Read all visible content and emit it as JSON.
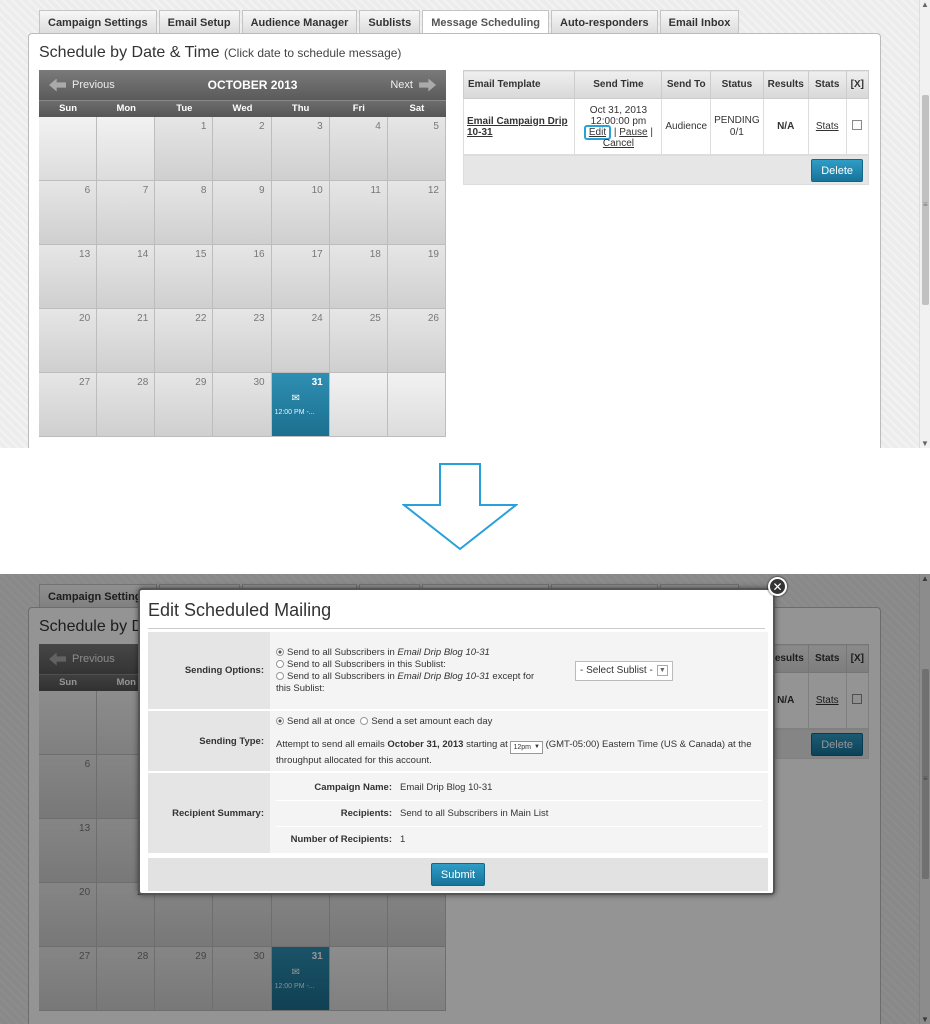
{
  "tabs": [
    "Campaign Settings",
    "Email Setup",
    "Audience Manager",
    "Sublists",
    "Message Scheduling",
    "Auto-responders",
    "Email Inbox"
  ],
  "active_tab": "Message Scheduling",
  "schedule": {
    "title": "Schedule by Date & Time",
    "hint": "(Click date to schedule message)"
  },
  "calendar": {
    "prev_label": "Previous",
    "next_label": "Next",
    "month": "OCTOBER 2013",
    "weekdays": [
      "Sun",
      "Mon",
      "Tue",
      "Wed",
      "Thu",
      "Fri",
      "Sat"
    ],
    "weeks": [
      [
        "",
        "",
        "1",
        "2",
        "3",
        "4",
        "5"
      ],
      [
        "6",
        "7",
        "8",
        "9",
        "10",
        "11",
        "12"
      ],
      [
        "13",
        "14",
        "15",
        "16",
        "17",
        "18",
        "19"
      ],
      [
        "20",
        "21",
        "22",
        "23",
        "24",
        "25",
        "26"
      ],
      [
        "27",
        "28",
        "29",
        "30",
        "31",
        "",
        ""
      ]
    ],
    "event_day": "31",
    "event_time": "12:00 PM -..."
  },
  "table": {
    "headers": [
      "Email Template",
      "Send Time",
      "Send To",
      "Status",
      "Results",
      "Stats",
      "[X]"
    ],
    "row": {
      "template": "Email Campaign Drip 10-31",
      "send_date": "Oct 31, 2013",
      "send_time": "12:00:00 pm",
      "edit": "Edit",
      "pause": "Pause",
      "cancel": "Cancel",
      "send_to": "Audience",
      "status": "PENDING",
      "status_count": "0/1",
      "results": "N/A",
      "stats": "Stats"
    },
    "delete_label": "Delete"
  },
  "modal": {
    "title": "Edit Scheduled Mailing",
    "sending_options_label": "Sending Options:",
    "opt1_pre": "Send to all Subscribers in ",
    "opt1_em": "Email Drip Blog 10-31",
    "opt2": "Send to all Subscribers in this Sublist:",
    "opt3_pre": "Send to all Subscribers in ",
    "opt3_em": "Email Drip Blog 10-31",
    "opt3_post": " except for this Sublist:",
    "sublist_select": "- Select Sublist -",
    "sending_type_label": "Sending Type:",
    "type_all": "Send all at once",
    "type_amount": "Send a set amount each day",
    "attempt_pre": "Attempt to send all emails ",
    "attempt_date": "October 31, 2013",
    "attempt_mid": " starting at ",
    "attempt_time": "12pm",
    "attempt_post": " (GMT-05:00) Eastern Time (US & Canada) at the throughput allocated for this account.",
    "recipient_summary_label": "Recipient Summary:",
    "campaign_name_label": "Campaign Name:",
    "campaign_name": "Email Drip Blog 10-31",
    "recipients_label": "Recipients:",
    "recipients": "Send to all Subscribers in Main List",
    "num_recipients_label": "Number of Recipients:",
    "num_recipients": "1",
    "submit": "Submit"
  },
  "colors": {
    "accent": "#1f7ea6",
    "highlight": "#2aa0d8"
  }
}
